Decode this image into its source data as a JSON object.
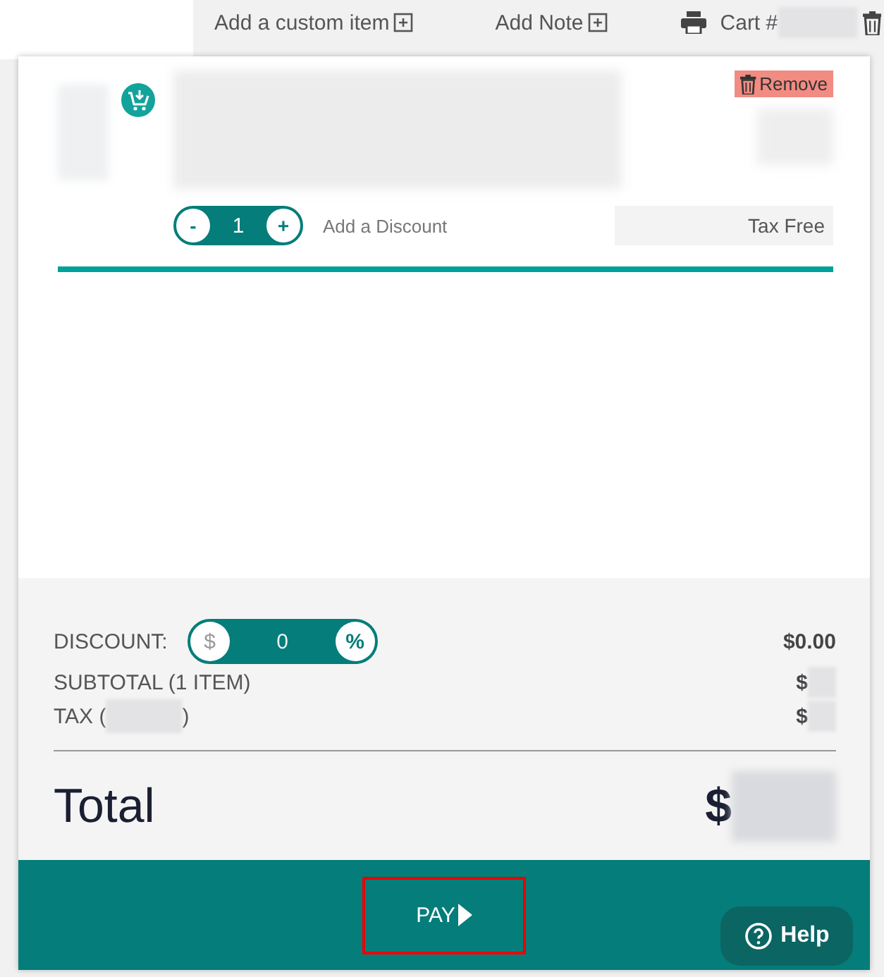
{
  "toolbar": {
    "actions": [
      {
        "kind": "add",
        "label": "Add a custom item"
      },
      {
        "kind": "add",
        "label": "Add Note"
      }
    ],
    "cart_label": "Cart #"
  },
  "line_item": {
    "remove_label": "Remove",
    "quantity": "1",
    "decrement": "-",
    "increment": "+",
    "discount_link": "Add a Discount",
    "tax_field": "Tax Free"
  },
  "summary": {
    "discount_label": "DISCOUNT:",
    "discount_modes": [
      {
        "label": "$",
        "selected": false
      },
      {
        "label": "%",
        "selected": true
      }
    ],
    "discount_value": "0",
    "discount_amount": "$0.00",
    "subtotal_label": "SUBTOTAL (1 ITEM)",
    "subtotal_prefix": "$",
    "tax_prefix": "TAX (",
    "tax_suffix": ")",
    "tax_amount_prefix": "$",
    "total_label": "Total",
    "total_prefix": "$"
  },
  "pay_label": "PAY",
  "help_label": "Help"
}
